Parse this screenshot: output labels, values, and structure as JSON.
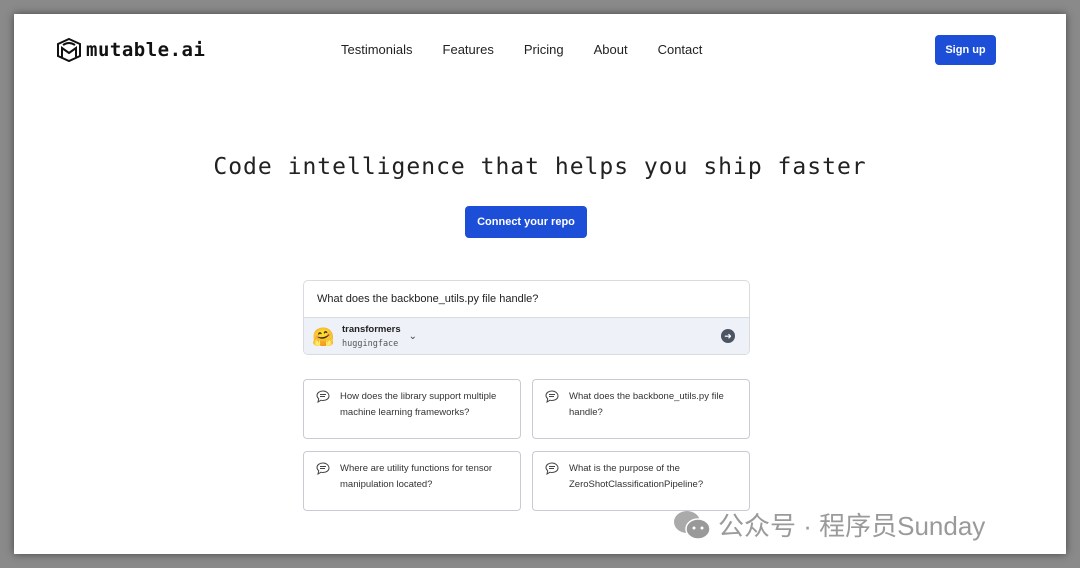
{
  "header": {
    "logo": "mutable.ai",
    "nav": [
      "Testimonials",
      "Features",
      "Pricing",
      "About",
      "Contact"
    ],
    "signup": "Sign up"
  },
  "hero": {
    "title": "Code intelligence that helps you ship faster",
    "cta": "Connect your repo"
  },
  "query": {
    "value": "What does the backbone_utils.py file handle?",
    "repo_name": "transformers",
    "repo_owner": "huggingface"
  },
  "suggestions": [
    "How does the library support multiple machine learning frameworks?",
    "What does the backbone_utils.py file handle?",
    "Where are utility functions for tensor manipulation located?",
    "What is the purpose of the ZeroShotClassificationPipeline?"
  ],
  "watermark": "公众号 · 程序员Sunday",
  "colors": {
    "accent": "#1d4ed8"
  }
}
